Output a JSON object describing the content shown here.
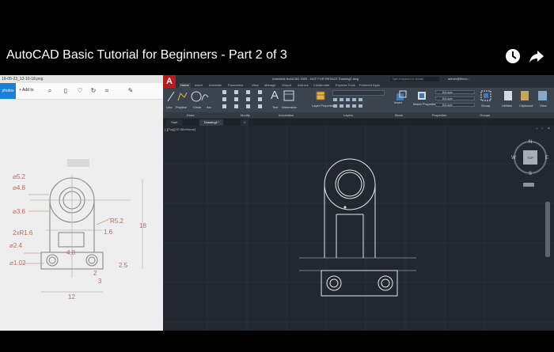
{
  "video": {
    "title": "AutoCAD Basic Tutorial for Beginners - Part 2 of 3",
    "watch_later_icon": "clock-icon",
    "share_icon": "share-arrow-icon"
  },
  "viewer": {
    "filename": "19-05-23_12-10-18.png",
    "photos_button": "photos",
    "add_to_button": "+ Add to",
    "toolbar_icons": [
      "zoom-in-icon",
      "trash-icon",
      "heart-icon",
      "rotate-icon",
      "crop-icon",
      "edit-icon"
    ],
    "drawing_dims": {
      "d1": "⌀5.2",
      "d2": "⌀4.8",
      "d3": "⌀3.6",
      "d4": "R5.2",
      "d5": "1.6",
      "d6": "2xR1.6",
      "d7": "⌀2.4",
      "d8": "⌀1.02",
      "d9": "4.8",
      "d10": "2.5",
      "d11": "12",
      "d12": "18",
      "d13": "3",
      "d14": "2"
    }
  },
  "autocad": {
    "logo": "A",
    "title": "Autodesk AutoCAD 2020 - NOT FOR RESALE   Drawing1.dwg",
    "search_placeholder": "Type a keyword or phrase",
    "user": "admin@theco...",
    "ribbon_tabs": [
      "Home",
      "Insert",
      "Annotate",
      "Parametric",
      "View",
      "Manage",
      "Output",
      "Add-ins",
      "Collaborate",
      "Express Tools",
      "Featured Apps"
    ],
    "draw_tools": [
      "Line",
      "Polyline",
      "Circle",
      "Arc"
    ],
    "annotation_tools": [
      "Text",
      "Dimension"
    ],
    "layer_tool": "Layer Properties",
    "block_tool": "Insert",
    "props_tool": "Match Properties",
    "bylayer": "ByLayer",
    "group_tool": "Group",
    "util_tools": [
      "Utilities",
      "Clipboard",
      "View"
    ],
    "panels": [
      "Draw",
      "Modify",
      "Annotation",
      "Layers",
      "Block",
      "Properties",
      "Groups"
    ],
    "doc_tabs": [
      "Start",
      "Drawing1*"
    ],
    "viewport_label": "[-][Top][2D Wireframe]",
    "viewcube": {
      "n": "N",
      "s": "S",
      "e": "E",
      "w": "W",
      "face": "TOP"
    }
  }
}
